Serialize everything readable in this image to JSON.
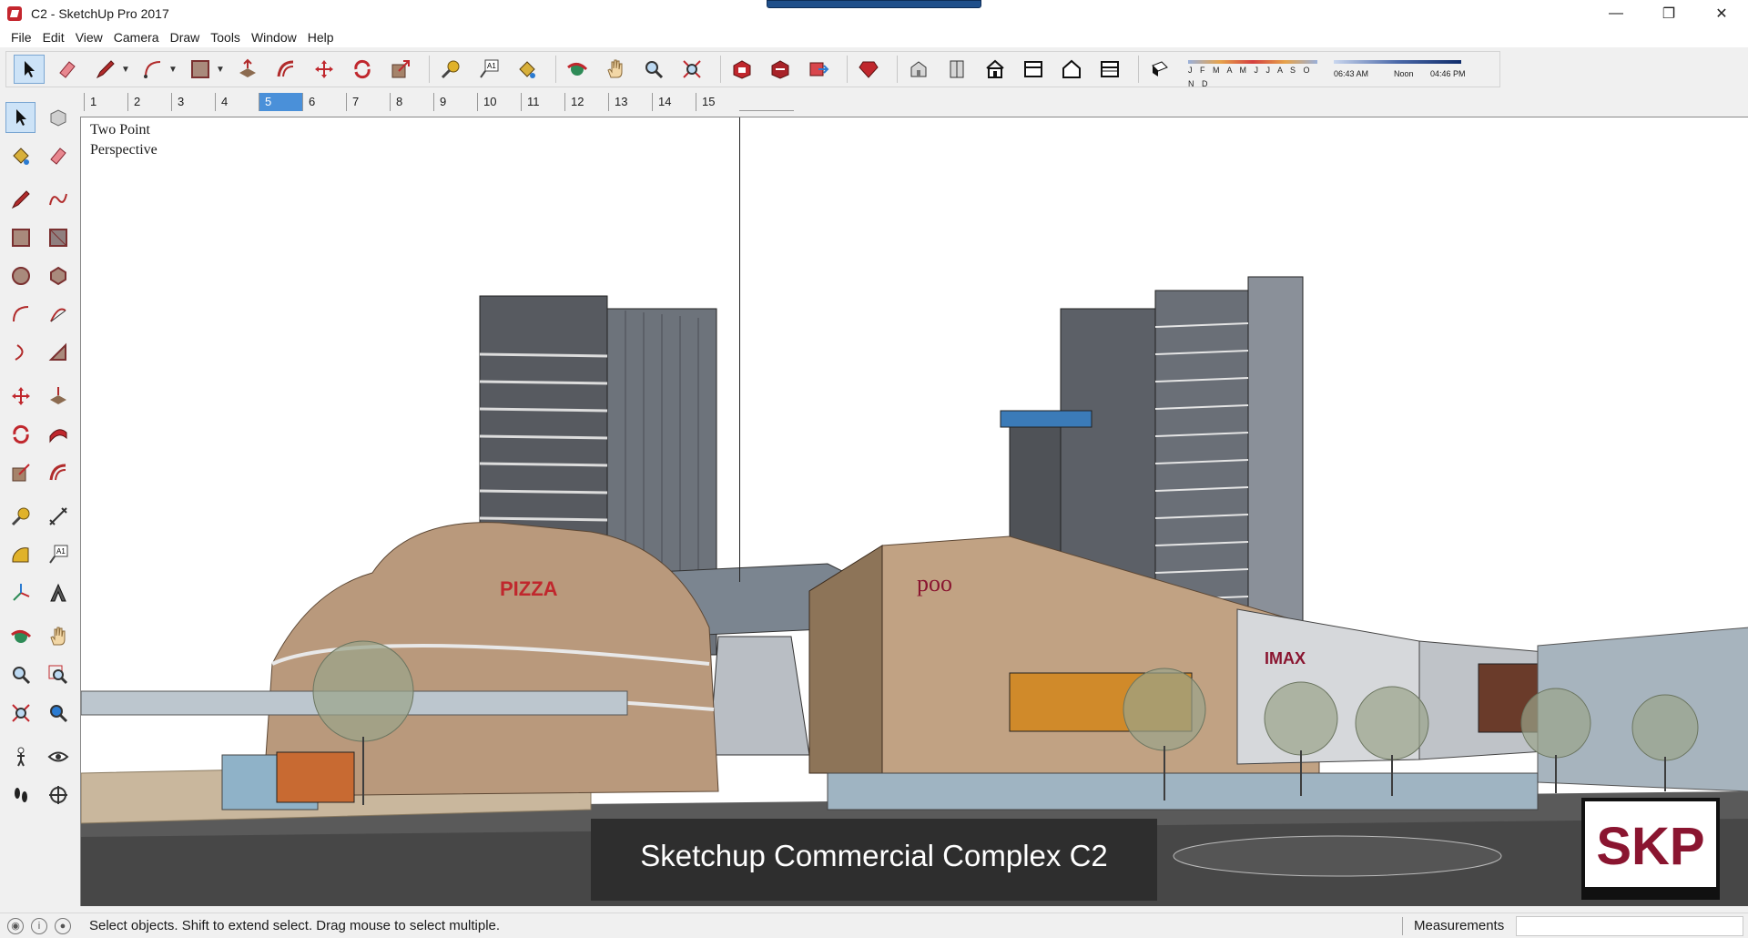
{
  "window": {
    "title": "C2 - SketchUp Pro 2017",
    "minimize": "—",
    "restore": "❐",
    "close": "✕"
  },
  "menu": [
    "File",
    "Edit",
    "View",
    "Camera",
    "Draw",
    "Tools",
    "Window",
    "Help"
  ],
  "toolbar": {
    "shadow_months": "J F M A M J J A S O N D",
    "time_start": "06:43 AM",
    "time_mid": "Noon",
    "time_end": "04:46 PM"
  },
  "scenes": {
    "tabs": [
      "1",
      "2",
      "3",
      "4",
      "5",
      "6",
      "7",
      "8",
      "9",
      "10",
      "11",
      "12",
      "13",
      "14",
      "15"
    ],
    "active": "5"
  },
  "viewport": {
    "view_label": "Two Point\nPerspective",
    "signs": [
      "PIZZA",
      "poo",
      "IMAX"
    ],
    "caption": "Sketchup Commercial Complex C2",
    "logo": "SKP"
  },
  "status": {
    "hint": "Select objects. Shift to extend select. Drag mouse to select multiple.",
    "measurements_label": "Measurements",
    "measurements_value": ""
  },
  "colors": {
    "accent": "#4a90d9",
    "brick": "#b9997c",
    "glass": "#6c6f76",
    "caption_bg": "#2e2e2e",
    "logo_text": "#8a1530"
  }
}
